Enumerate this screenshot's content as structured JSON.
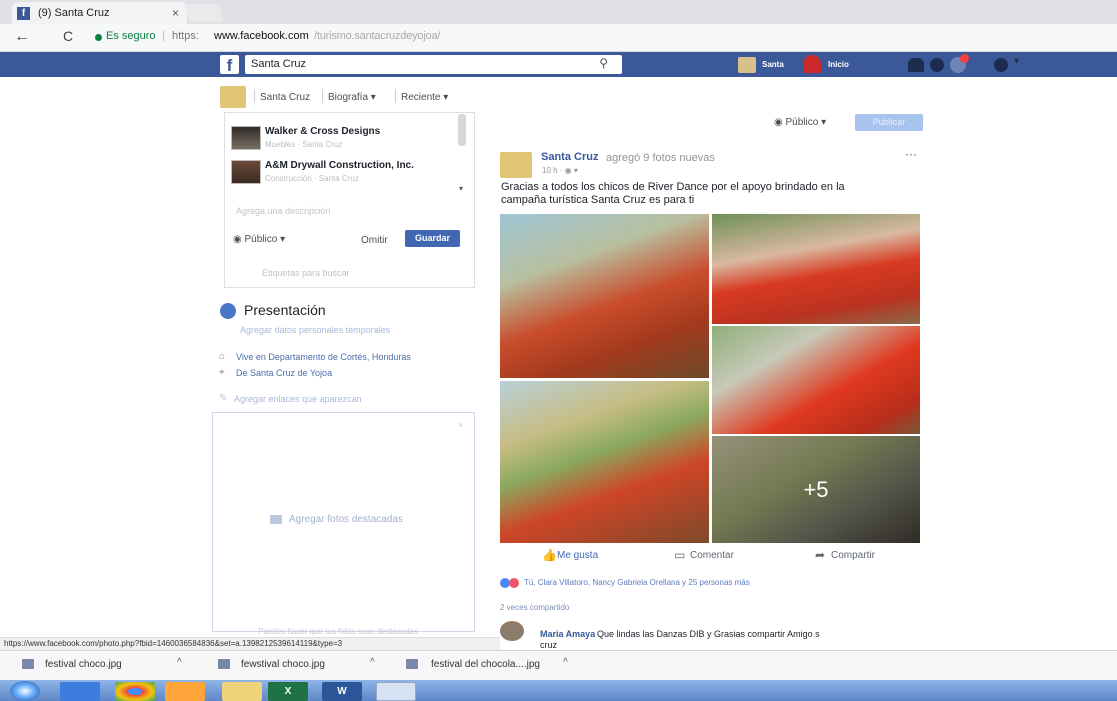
{
  "browser": {
    "tab_title": "(9) Santa Cruz",
    "tab_close": "×",
    "back": "←",
    "reload": "C",
    "secure_label": "Es seguro",
    "url_protocol": "https:",
    "url_host": "www.facebook.com",
    "url_path": "/turismo.santacruzdeyojoa/",
    "status_url": "https://www.facebook.com/photo.php?fbid=1460036584836&set=a.1398212539614119&type=3"
  },
  "fb_header": {
    "logo": "f",
    "search_value": "Santa Cruz",
    "search_icon": "⚲",
    "user_label": "Santa",
    "home_label": "Inicio",
    "caret": "▾"
  },
  "left": {
    "crumbs": [
      "Santa Cruz",
      "Biografía ▾",
      "Reciente ▾"
    ],
    "suggestions": [
      {
        "title": "Walker & Cross Designs",
        "subtitle": "Muebles · Santa Cruz"
      },
      {
        "title": "A&M Drywall Construction, Inc.",
        "subtitle": "Construcción · Santa Cruz"
      }
    ],
    "card_caret": "▾",
    "desc_placeholder": "Agrega una descripción",
    "privacy": "Público ▾",
    "omit": "Omitir",
    "save": "Guardar",
    "tag_link": "Etiquetas para buscar",
    "intro_title": "Presentación",
    "intro_temp": "Agregar datos personales temporales",
    "lives_in": "Vive en Departamento de Cortés, Honduras",
    "from": "De Santa Cruz de Yojoa",
    "add_links": "Agregar enlaces que aparezcan",
    "add_photos": "Agregar fotos destacadas",
    "photos_footnote": "Puedes hacer que tus fotos sean destacadas",
    "close": "×"
  },
  "composer": {
    "privacy": "Público ▾",
    "publish": "Publicar"
  },
  "post": {
    "author": "Santa Cruz",
    "action": "agregó 9 fotos nuevas",
    "time": "10 h · ◉ ▾",
    "more": "···",
    "text": "Gracias a todos los chicos de River Dance por el apoyo brindado en la campaña turística Santa Cruz es para ti",
    "more_photos": "+5",
    "like": "Me gusta",
    "comment": "Comentar",
    "share": "Compartir",
    "reactions": "Tú, Clara Villatoro, Nancy Gabriela Orellana y 25 personas más",
    "shares": "2 veces compartido",
    "comment_author": "Maria Amaya",
    "comment_text": "Que lindas las Danzas DIB y Grasias compartir Amigo s",
    "comment_text2": "cruz"
  },
  "downloads": [
    {
      "name": "festival choco.jpg"
    },
    {
      "name": "fewstival choco.jpg"
    },
    {
      "name": "festival del chocola....jpg"
    }
  ],
  "download_caret": "^",
  "taskbar": {
    "excel": "X",
    "word": "W"
  },
  "colors": {
    "fb_blue": "#3b5998",
    "button_blue": "#4267b2",
    "link_blue": "#365899"
  }
}
